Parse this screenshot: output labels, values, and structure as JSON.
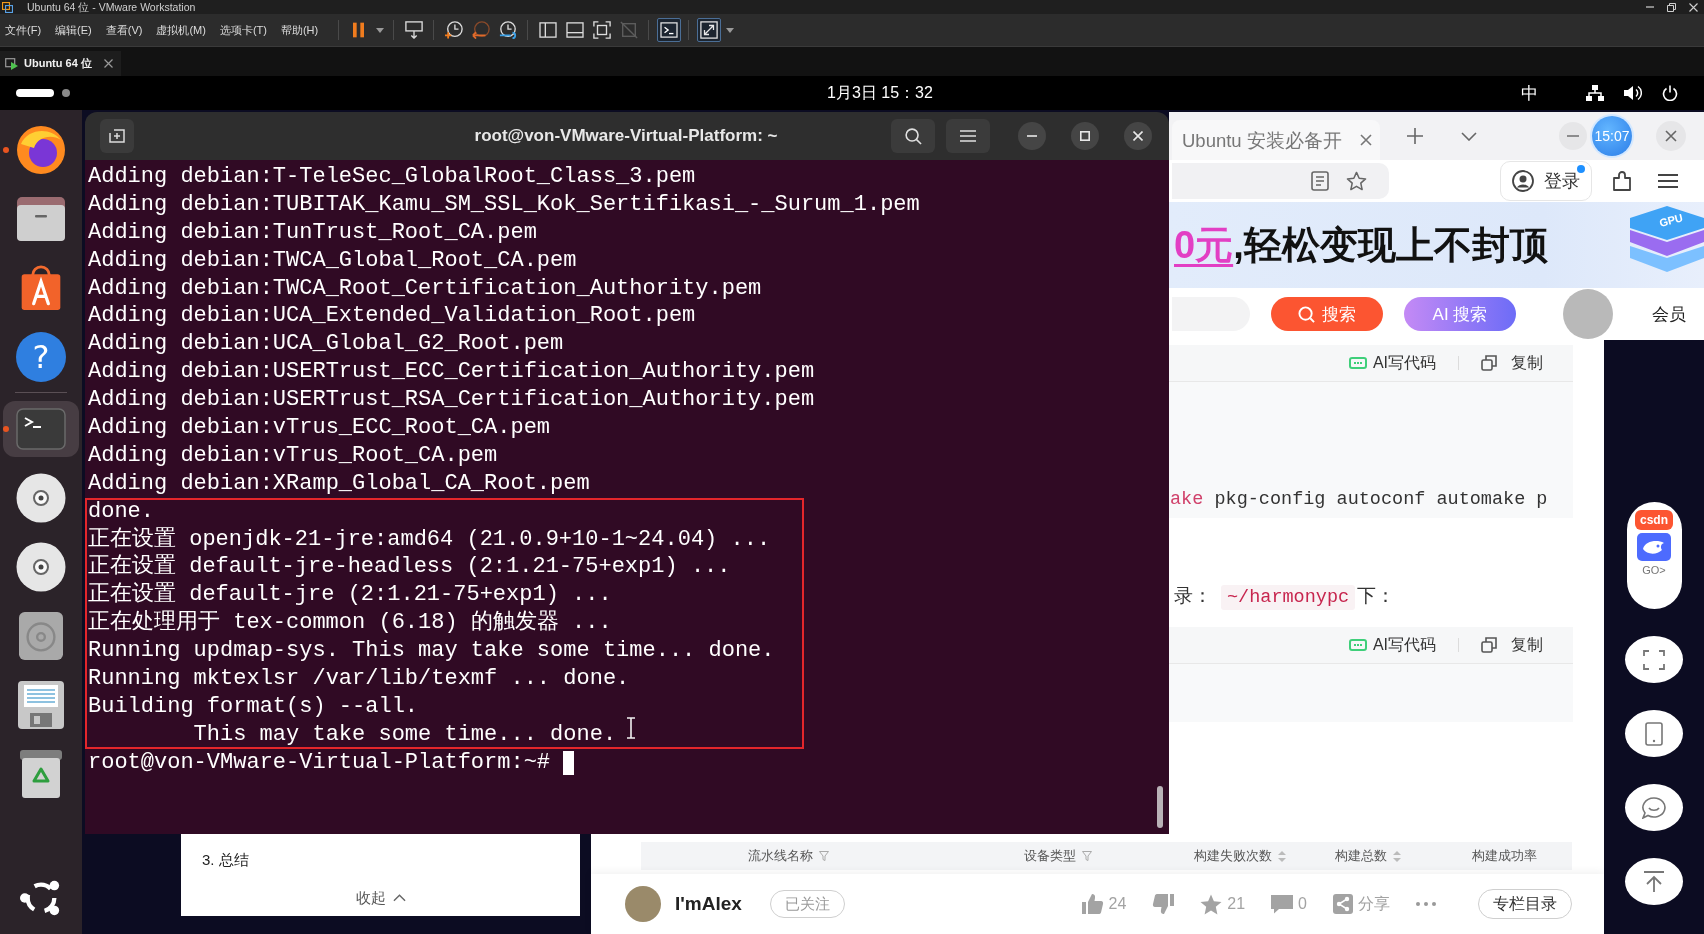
{
  "vmware": {
    "title": "Ubuntu 64 位 - VMware Workstation",
    "menu": [
      "文件(F)",
      "编辑(E)",
      "查看(V)",
      "虚拟机(M)",
      "选项卡(T)",
      "帮助(H)"
    ],
    "toolbar": [
      [
        {
          "kind": "pause",
          "selected": false,
          "disabled": false
        },
        {
          "kind": "caret",
          "selected": false,
          "disabled": false
        }
      ],
      [
        {
          "kind": "send-keys",
          "selected": false,
          "disabled": false
        }
      ],
      [
        {
          "kind": "snapshot",
          "selected": false,
          "disabled": false
        },
        {
          "kind": "revert",
          "selected": false,
          "disabled": false
        },
        {
          "kind": "snapshot-manager",
          "selected": false,
          "disabled": false
        }
      ],
      [
        {
          "kind": "sidebar",
          "selected": false,
          "disabled": false
        },
        {
          "kind": "thumbnails",
          "selected": false,
          "disabled": false
        },
        {
          "kind": "fit",
          "selected": false,
          "disabled": false
        },
        {
          "kind": "unity",
          "selected": false,
          "disabled": true
        }
      ],
      [
        {
          "kind": "console",
          "selected": true,
          "disabled": false
        }
      ],
      [
        {
          "kind": "fullscreen",
          "selected": true,
          "disabled": false
        },
        {
          "kind": "caret",
          "selected": false,
          "disabled": false
        }
      ]
    ],
    "tabs": [
      {
        "label": "Ubuntu 64 位",
        "selected": true
      }
    ]
  },
  "topbar": {
    "workspaces": [
      {
        "selected": true
      },
      {
        "selected": false
      }
    ],
    "clock": "1月3日 15：32",
    "input_method": "中"
  },
  "dock": {
    "groups": [
      [
        {
          "kind": "browser",
          "running": true,
          "selected": false
        },
        {
          "kind": "files",
          "running": false,
          "selected": false
        },
        {
          "kind": "app-store",
          "running": false,
          "selected": false
        },
        {
          "kind": "help",
          "glyph": "?",
          "running": false,
          "selected": false
        }
      ],
      [
        {
          "kind": "terminal",
          "running": true,
          "selected": true
        },
        {
          "kind": "disc",
          "running": false,
          "selected": false
        },
        {
          "kind": "disc",
          "running": false,
          "selected": false
        },
        {
          "kind": "disk-utility",
          "running": false,
          "selected": false
        },
        {
          "kind": "save",
          "running": false,
          "selected": false
        },
        {
          "kind": "trash",
          "running": false,
          "selected": false
        }
      ]
    ],
    "bottom": [
      {
        "kind": "apps",
        "running": false,
        "selected": false
      }
    ]
  },
  "terminal": {
    "title": "root@von-VMware-Virtual-Platform: ~",
    "blocks": [
      {
        "highlighted": false,
        "lines": [
          {
            "kind": "output",
            "text": "Adding debian:T-TeleSec_GlobalRoot_Class_3.pem"
          },
          {
            "kind": "output",
            "text": "Adding debian:TUBITAK_Kamu_SM_SSL_Kok_Sertifikasi_-_Surum_1.pem"
          },
          {
            "kind": "output",
            "text": "Adding debian:TunTrust_Root_CA.pem"
          },
          {
            "kind": "output",
            "text": "Adding debian:TWCA_Global_Root_CA.pem"
          },
          {
            "kind": "output",
            "text": "Adding debian:TWCA_Root_Certification_Authority.pem"
          },
          {
            "kind": "output",
            "text": "Adding debian:UCA_Extended_Validation_Root.pem"
          },
          {
            "kind": "output",
            "text": "Adding debian:UCA_Global_G2_Root.pem"
          },
          {
            "kind": "output",
            "text": "Adding debian:USERTrust_ECC_Certification_Authority.pem"
          },
          {
            "kind": "output",
            "text": "Adding debian:USERTrust_RSA_Certification_Authority.pem"
          },
          {
            "kind": "output",
            "text": "Adding debian:vTrus_ECC_Root_CA.pem"
          },
          {
            "kind": "output",
            "text": "Adding debian:vTrus_Root_CA.pem"
          },
          {
            "kind": "output",
            "text": "Adding debian:XRamp_Global_CA_Root.pem"
          }
        ]
      },
      {
        "highlighted": true,
        "lines": [
          {
            "kind": "output",
            "text": "done."
          },
          {
            "kind": "output",
            "text": "正在设置 openjdk-21-jre:amd64 (21.0.9+10-1~24.04) ..."
          },
          {
            "kind": "output",
            "text": "正在设置 default-jre-headless (2:1.21-75+exp1) ..."
          },
          {
            "kind": "output",
            "text": "正在设置 default-jre (2:1.21-75+exp1) ..."
          },
          {
            "kind": "output",
            "text": "正在处理用于 tex-common (6.18) 的触发器 ..."
          },
          {
            "kind": "output",
            "text": "Running updmap-sys. This may take some time... done."
          },
          {
            "kind": "output",
            "text": "Running mktexlsr /var/lib/texmf ... done."
          },
          {
            "kind": "output",
            "text": "Building format(s) --all."
          },
          {
            "kind": "continuation",
            "text": "This may take some time... done."
          }
        ]
      }
    ],
    "prompt": "root@von-VMware-Virtual-Platform:~#"
  },
  "browser": {
    "tabs": [
      {
        "title": "Ubuntu 安装必备开"
      }
    ],
    "clock_badge": "15:07",
    "login": {
      "label": "登录",
      "notification": true
    },
    "banner": {
      "highlight": "0元",
      "text": ",轻松变现上不封顶",
      "art_label": "GPU"
    },
    "search_buttons": [
      {
        "kind": "search",
        "label": "搜索"
      },
      {
        "kind": "ai",
        "label": "AI 搜索"
      }
    ],
    "member": "会员",
    "toc": {
      "items": [
        "3. 总结"
      ],
      "collapse": "收起"
    },
    "article": [
      {
        "kind": "code-block",
        "actions": [
          {
            "kind": "ai",
            "label": "AI写代码"
          },
          {
            "kind": "copy",
            "label": "复制"
          }
        ],
        "lines": [
          [
            {
              "kind": "keyword",
              "text": "ake"
            },
            {
              "kind": "plain",
              "text": "pkg-config autoconf automake p"
            }
          ]
        ]
      },
      {
        "kind": "paragraph",
        "parts": [
          {
            "kind": "plain",
            "text": "录："
          },
          {
            "kind": "code",
            "text": "~/harmonypc"
          },
          {
            "kind": "plain",
            "text": "下："
          }
        ]
      },
      {
        "kind": "code-block",
        "actions": [
          {
            "kind": "ai",
            "label": "AI写代码"
          },
          {
            "kind": "copy",
            "label": "复制"
          }
        ]
      }
    ],
    "table": {
      "columns": [
        {
          "label": "流水线名称",
          "kind": "filter"
        },
        {
          "label": "设备类型",
          "kind": "filter"
        },
        {
          "label": "构建失败次数",
          "kind": "sort"
        },
        {
          "label": "构建总数",
          "kind": "sort"
        },
        {
          "label": "构建成功率",
          "kind": "plain"
        }
      ]
    },
    "author_bar": {
      "name": "I'mAlex",
      "follow": "已关注",
      "actions": [
        {
          "kind": "like",
          "count": "24"
        },
        {
          "kind": "dislike"
        },
        {
          "kind": "favorite",
          "count": "21"
        },
        {
          "kind": "comment",
          "count": "0"
        },
        {
          "kind": "share",
          "label": "分享"
        },
        {
          "kind": "more"
        }
      ],
      "column_button": "专栏目录"
    },
    "side_tools": [
      {
        "kind": "ai-assistant",
        "logo": "csdn",
        "label": "GO>"
      },
      {
        "kind": "fullscreen"
      },
      {
        "kind": "tablet"
      },
      {
        "kind": "chat"
      },
      {
        "kind": "back-to-top"
      }
    ]
  }
}
